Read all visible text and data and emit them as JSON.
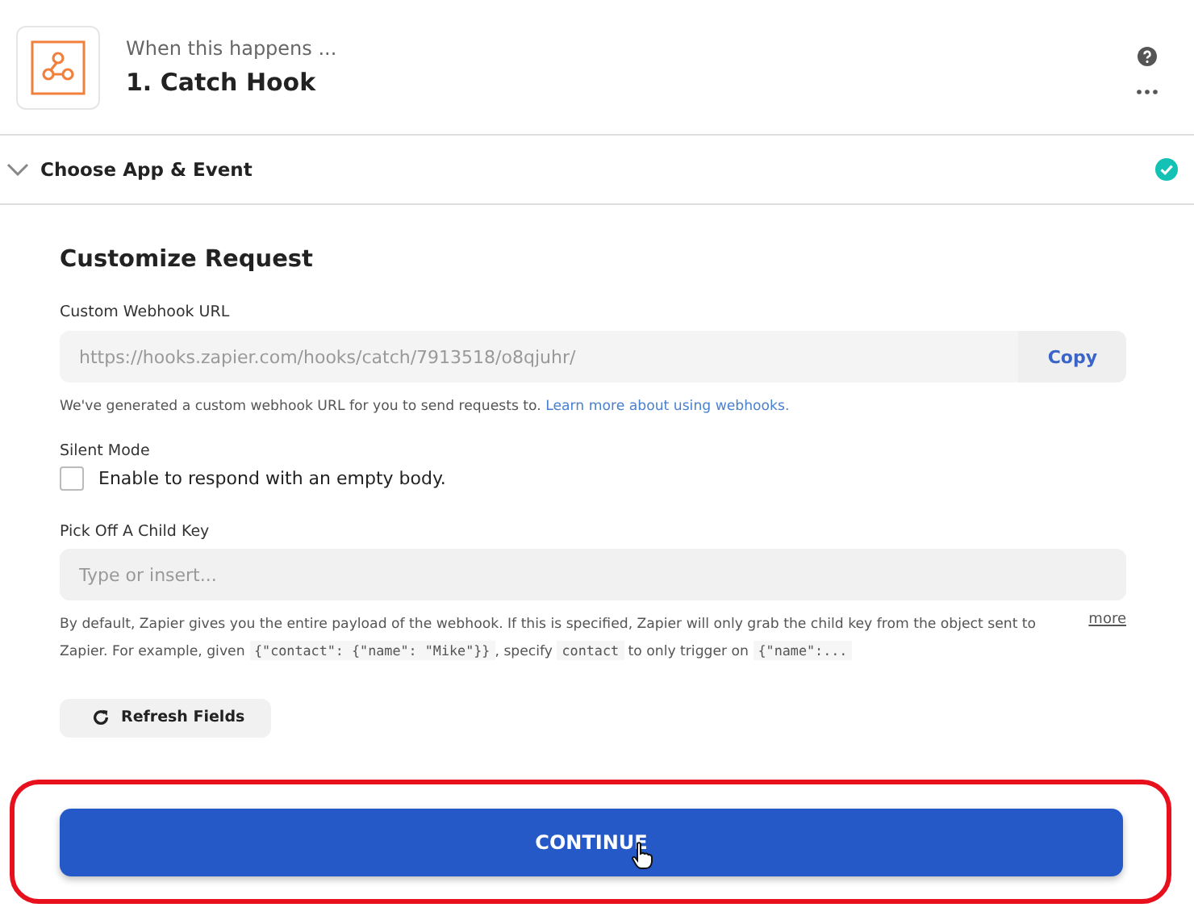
{
  "header": {
    "subtitle": "When this happens ...",
    "title": "1. Catch Hook"
  },
  "section": {
    "title": "Choose App & Event",
    "expanded": true,
    "complete": true
  },
  "form": {
    "heading": "Customize Request",
    "webhook": {
      "label": "Custom Webhook URL",
      "value": "https://hooks.zapier.com/hooks/catch/7913518/o8qjuhr/",
      "copy_label": "Copy",
      "help": "We've generated a custom webhook URL for you to send requests to.",
      "link": "Learn more about using webhooks."
    },
    "silent_mode": {
      "label": "Silent Mode",
      "checkbox_label": "Enable to respond with an empty body.",
      "checked": false
    },
    "child_key": {
      "label": "Pick Off A Child Key",
      "placeholder": "Type or insert...",
      "help": [
        {
          "kind": "text",
          "text": "By default, Zapier gives you the entire payload of the webhook. If this is specified, Zapier will only grab the child key from the object sent to Zapier. For example, given "
        },
        {
          "kind": "code",
          "text": "{\"contact\": {\"name\": \"Mike\"}}"
        },
        {
          "kind": "text",
          "text": ", specify "
        },
        {
          "kind": "code",
          "text": "contact"
        },
        {
          "kind": "text",
          "text": " to only trigger on "
        },
        {
          "kind": "code",
          "text": "{\"name\":..."
        }
      ],
      "more": "more"
    },
    "refresh_label": "Refresh Fields"
  },
  "continue_button": {
    "label": "CONTINUE",
    "highlighted": true
  }
}
